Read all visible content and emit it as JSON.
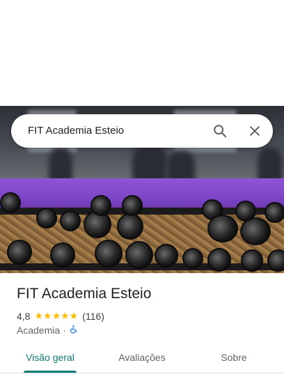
{
  "search": {
    "query": "FIT Academia Esteio",
    "search_icon": "search-icon",
    "close_icon": "close-icon"
  },
  "place": {
    "name": "FIT Academia Esteio",
    "rating": "4,8",
    "stars": "★★★★★",
    "review_count": "(116)",
    "category": "Academia",
    "separator": "·",
    "accessibility_icon": "wheelchair-icon"
  },
  "tabs": [
    {
      "label": "Visão geral",
      "active": true
    },
    {
      "label": "Avaliações",
      "active": false
    },
    {
      "label": "Sobre",
      "active": false
    }
  ],
  "colors": {
    "accent": "#0b7a75",
    "star": "#fbbc04",
    "accessibility": "#1a73e8"
  }
}
